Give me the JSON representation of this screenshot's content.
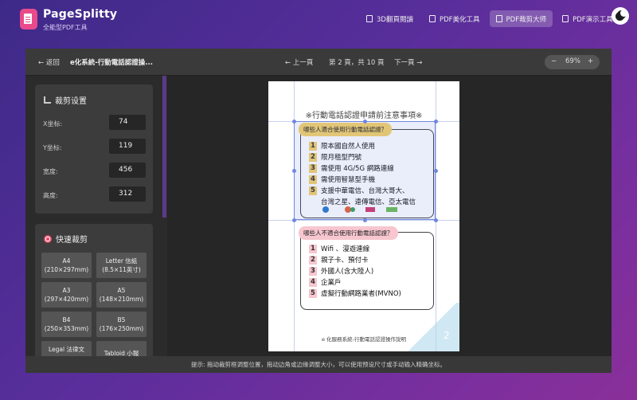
{
  "app": {
    "name": "PageSplitty",
    "tagline": "全能型PDF工具"
  },
  "nav": [
    {
      "label": "3D翻頁閱讀",
      "active": false
    },
    {
      "label": "PDF美化工具",
      "active": false
    },
    {
      "label": "PDF裁剪大师",
      "active": true
    },
    {
      "label": "PDF演示工具",
      "active": false
    }
  ],
  "toolbar": {
    "back": "← 返回",
    "doc_name": "e化系統-行動電話認證操...",
    "prev": "← 上一頁",
    "page_info": "第 2 頁，共 10 頁",
    "next": "下一頁 →",
    "zoom_out": "−",
    "zoom_value": "69%",
    "zoom_in": "+"
  },
  "crop": {
    "title": "裁剪设置",
    "fields": [
      {
        "label": "X坐标:",
        "value": "74"
      },
      {
        "label": "Y坐标:",
        "value": "119"
      },
      {
        "label": "宽度:",
        "value": "456"
      },
      {
        "label": "高度:",
        "value": "312"
      }
    ]
  },
  "quick": {
    "title": "快速裁剪",
    "presets": [
      {
        "name": "A4",
        "size": "(210×297mm)"
      },
      {
        "name": "Letter 信紙",
        "size": "(8.5×11英寸)"
      },
      {
        "name": "A3",
        "size": "(297×420mm)"
      },
      {
        "name": "A5",
        "size": "(148×210mm)"
      },
      {
        "name": "B4",
        "size": "(250×353mm)"
      },
      {
        "name": "B5",
        "size": "(176×250mm)"
      },
      {
        "name": "Legal 法律文",
        "size": ""
      },
      {
        "name": "Tabloid 小報",
        "size": ""
      }
    ]
  },
  "document": {
    "title": "※行動電話認證申請前注意事項※",
    "card1_head": "哪些人適合使用行動電話認證？",
    "card1_items": [
      "限本國自然人使用",
      "限月租型門號",
      "需使用 4G/5G 網路連線",
      "需使用智慧型手機",
      "支援中華電信、台灣大哥大、",
      "台灣之星、遠傳電信、亞太電信"
    ],
    "card2_head": "哪些人不適合使用行動電話認證？",
    "card2_items": [
      "Wifi 、漫遊連線",
      "親子卡、預付卡",
      "外國人(含大陸人)",
      "企業戶",
      "虛擬行動網路業者(MVNO)"
    ],
    "footer": "e 化服務系統-行動電話認證操作說明",
    "page_number": "2",
    "numbers1": [
      "1",
      "2",
      "3",
      "4",
      "5"
    ],
    "numbers2": [
      "1",
      "2",
      "3",
      "4",
      "5"
    ]
  },
  "hint": "提示: 拖动裁剪框调整位置，拖动边角或边缘调整大小，可以使用预设尺寸或手动输入精确坐标。"
}
